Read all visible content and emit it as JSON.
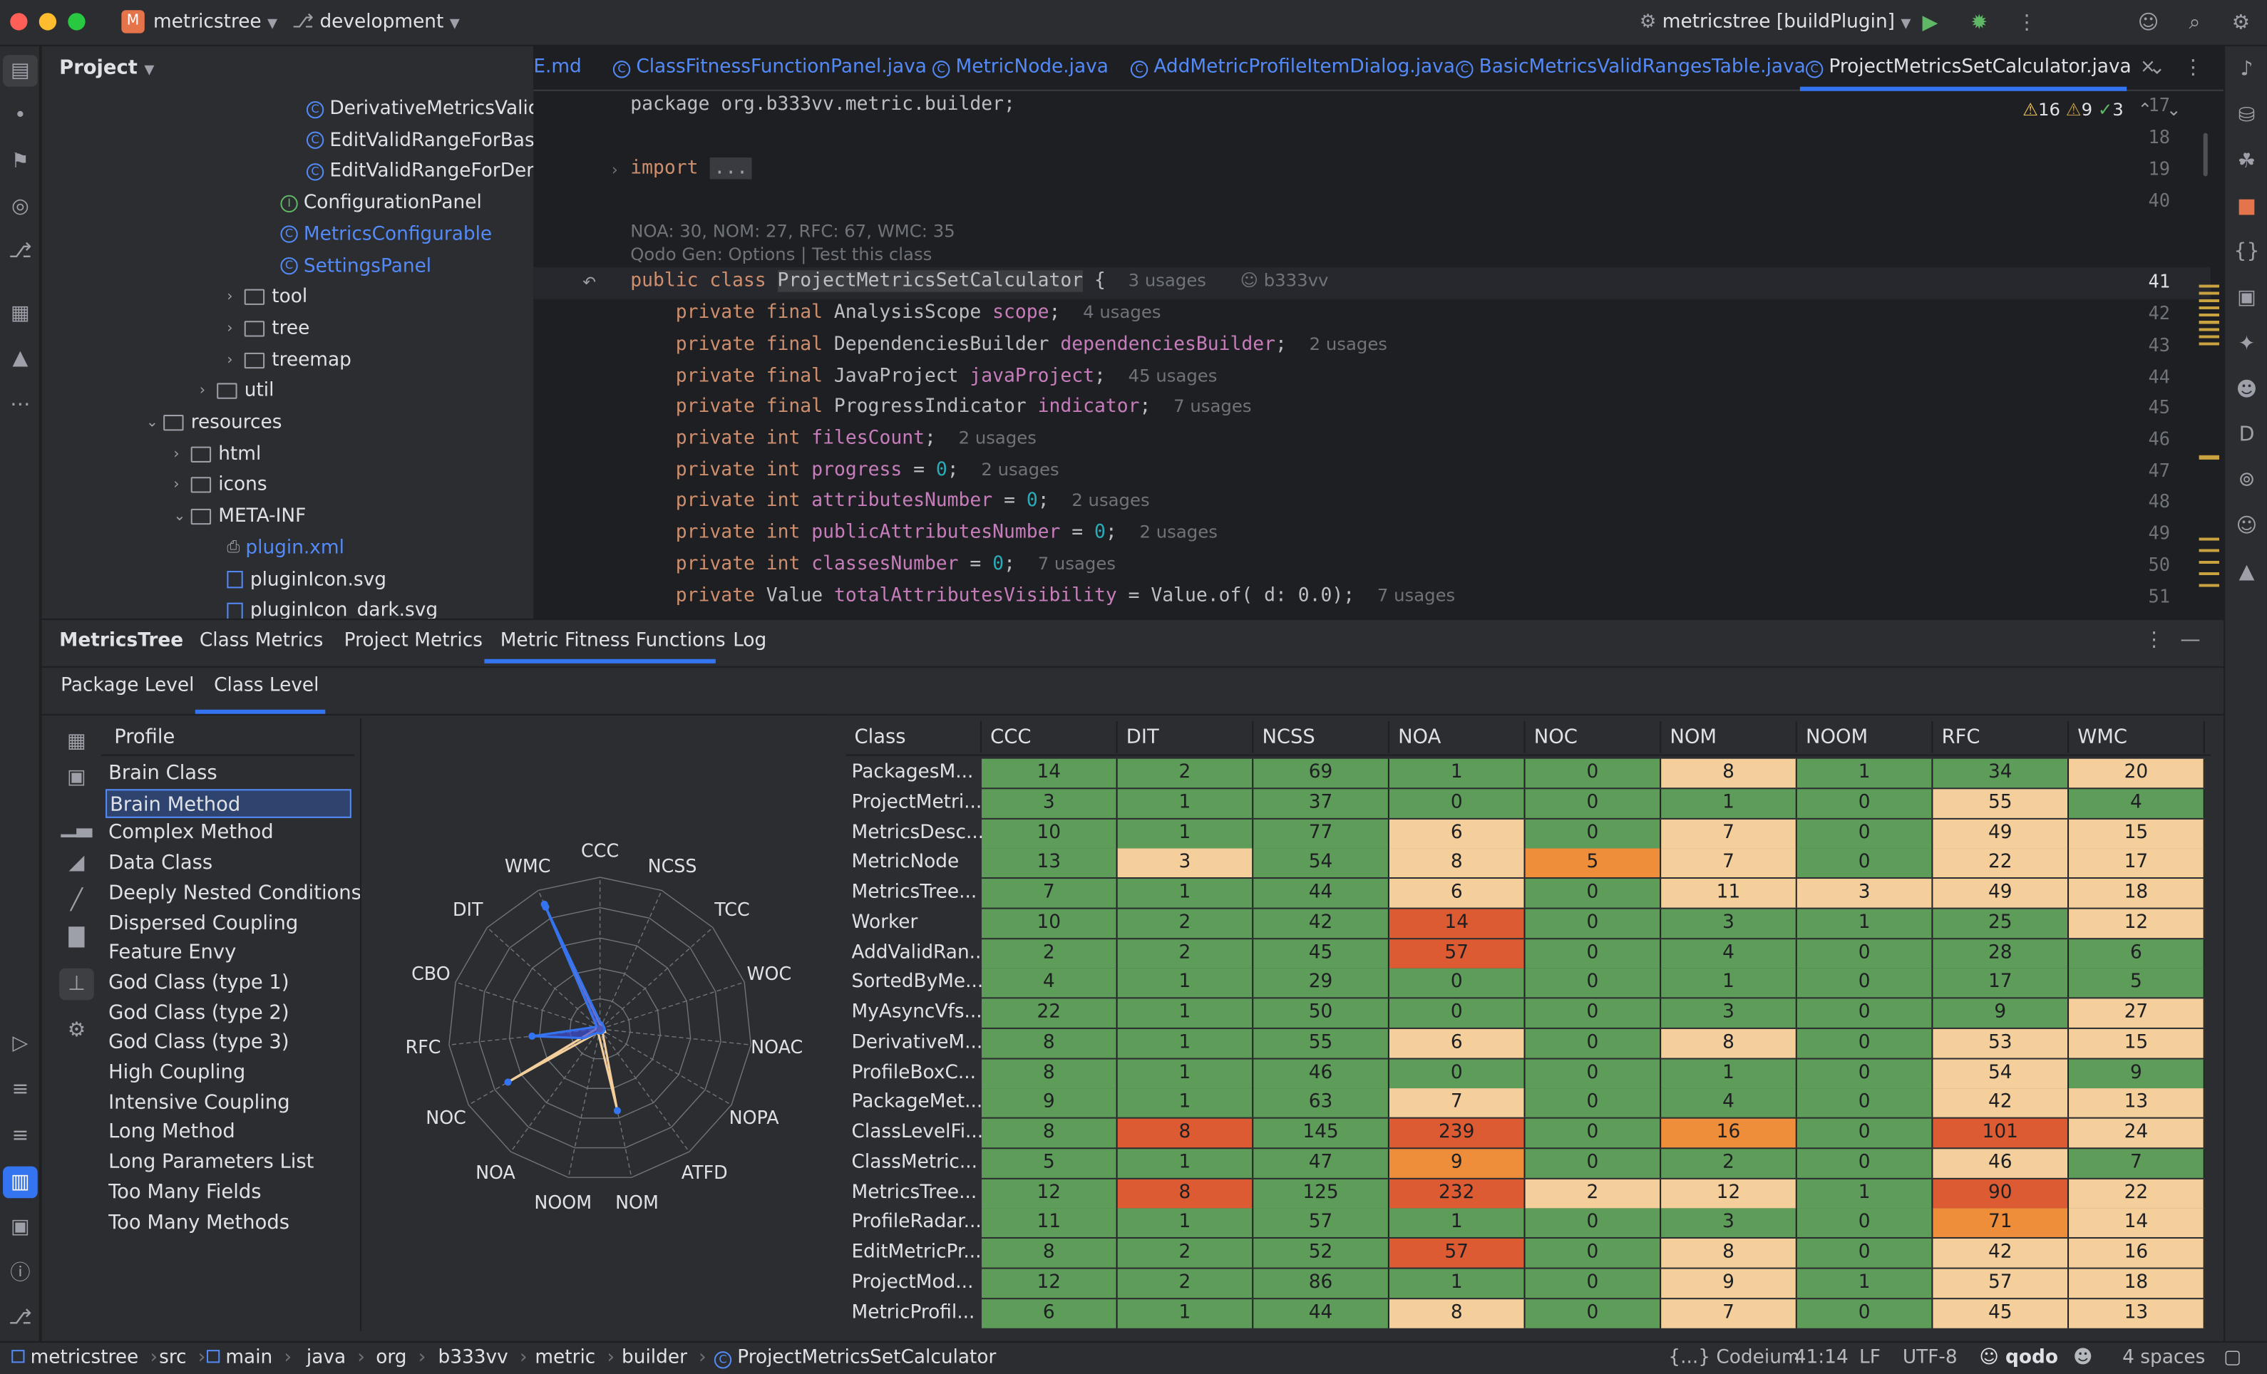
{
  "titlebar": {
    "project_initial": "M",
    "project": "metricstree",
    "branch": "development",
    "run_config": "metricstree [buildPlugin]"
  },
  "colors": {
    "green": "#5e9c5a",
    "tan": "#f4cf9c",
    "orange": "#ee8e3a",
    "red": "#dd5b33",
    "accent": "#3574f0",
    "selection": "#2e436e"
  },
  "project_panel": {
    "title": "Project",
    "items": [
      {
        "label": "DerivativeMetricsValidR",
        "kind": "class"
      },
      {
        "label": "EditValidRangeForBasic",
        "kind": "class"
      },
      {
        "label": "EditValidRangeForDeriv",
        "kind": "class"
      },
      {
        "label": "ConfigurationPanel",
        "kind": "interface"
      },
      {
        "label": "MetricsConfigurable",
        "kind": "class",
        "highlight": true
      },
      {
        "label": "SettingsPanel",
        "kind": "class",
        "highlight": true
      },
      {
        "label": "tool",
        "kind": "folder"
      },
      {
        "label": "tree",
        "kind": "folder"
      },
      {
        "label": "treemap",
        "kind": "folder"
      },
      {
        "label": "util",
        "kind": "folder"
      },
      {
        "label": "resources",
        "kind": "folder"
      },
      {
        "label": "html",
        "kind": "folder"
      },
      {
        "label": "icons",
        "kind": "folder"
      },
      {
        "label": "META-INF",
        "kind": "folder"
      },
      {
        "label": "plugin.xml",
        "kind": "xml"
      },
      {
        "label": "pluginIcon.svg",
        "kind": "svg"
      },
      {
        "label": "pluginIcon_dark.svg",
        "kind": "svg"
      }
    ]
  },
  "editor": {
    "tabs": [
      "E.md",
      "ClassFitnessFunctionPanel.java",
      "MetricNode.java",
      "AddMetricProfileItemDialog.java",
      "BasicMetricsValidRangesTable.java",
      "ProjectMetricsSetCalculator.java"
    ],
    "inspections": {
      "warnings": "16",
      "weak": "9",
      "ok": "3"
    },
    "line_numbers": [
      "17",
      "18",
      "19",
      "40",
      "41",
      "42",
      "43",
      "44",
      "45",
      "46",
      "47",
      "48",
      "49",
      "50",
      "51"
    ],
    "package_line": "package org.b333vv.metric.builder;",
    "import_line": "import",
    "import_fold": "...",
    "metrics_hint": "NOA: 30, NOM: 27, RFC: 67, WMC: 35",
    "qodo_hint": "Qodo Gen: Options | Test this class",
    "class_line": {
      "kw": "public class",
      "name": "ProjectMetricsSetCalculator",
      "brace": "{",
      "usages": "3 usages",
      "author": "b333vv"
    },
    "fields": [
      {
        "type": "AnalysisScope",
        "name": "scope",
        "init": "",
        "usages": "4 usages"
      },
      {
        "type": "DependenciesBuilder",
        "name": "dependenciesBuilder",
        "init": "",
        "usages": "2 usages"
      },
      {
        "type": "JavaProject",
        "name": "javaProject",
        "init": "",
        "usages": "45 usages"
      },
      {
        "type": "ProgressIndicator",
        "name": "indicator",
        "init": "",
        "usages": "7 usages"
      },
      {
        "type": "int",
        "name": "filesCount",
        "init": "",
        "usages": "2 usages"
      },
      {
        "type": "int",
        "name": "progress",
        "init": "0",
        "usages": "2 usages"
      },
      {
        "type": "int",
        "name": "attributesNumber",
        "init": "0",
        "usages": "2 usages"
      },
      {
        "type": "int",
        "name": "publicAttributesNumber",
        "init": "0",
        "usages": "2 usages"
      },
      {
        "type": "int",
        "name": "classesNumber",
        "init": "0",
        "usages": "7 usages"
      },
      {
        "type": "Value",
        "name": "totalAttributesVisibility",
        "init": "Value.of( d: 0.0)",
        "usages": "7 usages"
      }
    ]
  },
  "tool_window": {
    "title": "MetricsTree",
    "tabs": [
      "Class Metrics",
      "Project Metrics",
      "Metric Fitness Functions",
      "Log"
    ],
    "subtabs": [
      "Package Level",
      "Class Level"
    ],
    "profile_header": "Profile",
    "profiles": [
      "Brain Class",
      "Brain Method",
      "Complex Method",
      "Data Class",
      "Deeply Nested Conditions",
      "Dispersed Coupling",
      "Feature Envy",
      "God Class (type 1)",
      "God Class (type 2)",
      "God Class (type 3)",
      "High Coupling",
      "Intensive Coupling",
      "Long Method",
      "Long Parameters List",
      "Too Many Fields",
      "Too Many Methods"
    ],
    "selected_profile": "Brain Method"
  },
  "radar": {
    "axes": [
      "CCC",
      "NCSS",
      "TCC",
      "WOC",
      "NOAC",
      "NOPA",
      "ATFD",
      "NOM",
      "NOOM",
      "NOA",
      "NOC",
      "RFC",
      "CBO",
      "DIT",
      "WMC"
    ],
    "blue_shape": [
      0.05,
      0.04,
      0.03,
      0.03,
      0.03,
      0.03,
      0.03,
      0.03,
      0.03,
      0.03,
      0.12,
      0.45,
      0.04,
      0.03,
      0.9
    ],
    "tan_shape": [
      0.03,
      0.03,
      0.03,
      0.03,
      0.03,
      0.04,
      0.03,
      0.55,
      0.04,
      0.03,
      0.7,
      0.03,
      0.03,
      0.03,
      0.88
    ]
  },
  "table": {
    "columns": [
      "Class",
      "CCC",
      "DIT",
      "NCSS",
      "NOA",
      "NOC",
      "NOM",
      "NOOM",
      "RFC",
      "WMC"
    ],
    "rows": [
      {
        "name": "PackagesM...",
        "v": [
          "14",
          "2",
          "69",
          "1",
          "0",
          "8",
          "1",
          "34",
          "20"
        ],
        "c": [
          "g",
          "g",
          "g",
          "g",
          "g",
          "t",
          "g",
          "g",
          "t"
        ]
      },
      {
        "name": "ProjectMetri...",
        "v": [
          "3",
          "1",
          "37",
          "0",
          "0",
          "1",
          "0",
          "55",
          "4"
        ],
        "c": [
          "g",
          "g",
          "g",
          "g",
          "g",
          "g",
          "g",
          "t",
          "g"
        ]
      },
      {
        "name": "MetricsDesc...",
        "v": [
          "10",
          "1",
          "77",
          "6",
          "0",
          "7",
          "0",
          "49",
          "15"
        ],
        "c": [
          "g",
          "g",
          "g",
          "t",
          "g",
          "t",
          "g",
          "t",
          "t"
        ]
      },
      {
        "name": "MetricNode",
        "v": [
          "13",
          "3",
          "54",
          "8",
          "5",
          "7",
          "0",
          "22",
          "17"
        ],
        "c": [
          "g",
          "t",
          "g",
          "t",
          "o",
          "t",
          "g",
          "t",
          "t"
        ]
      },
      {
        "name": "MetricsTree...",
        "v": [
          "7",
          "1",
          "44",
          "6",
          "0",
          "11",
          "3",
          "49",
          "18"
        ],
        "c": [
          "g",
          "g",
          "g",
          "t",
          "g",
          "t",
          "t",
          "t",
          "t"
        ]
      },
      {
        "name": "Worker",
        "v": [
          "10",
          "2",
          "42",
          "14",
          "0",
          "3",
          "1",
          "25",
          "12"
        ],
        "c": [
          "g",
          "g",
          "g",
          "r",
          "g",
          "g",
          "g",
          "g",
          "t"
        ]
      },
      {
        "name": "AddValidRan...",
        "v": [
          "2",
          "2",
          "45",
          "57",
          "0",
          "4",
          "0",
          "28",
          "6"
        ],
        "c": [
          "g",
          "g",
          "g",
          "r",
          "g",
          "g",
          "g",
          "g",
          "g"
        ]
      },
      {
        "name": "SortedByMe...",
        "v": [
          "4",
          "1",
          "29",
          "0",
          "0",
          "1",
          "0",
          "17",
          "5"
        ],
        "c": [
          "g",
          "g",
          "g",
          "g",
          "g",
          "g",
          "g",
          "g",
          "g"
        ]
      },
      {
        "name": "MyAsyncVfs...",
        "v": [
          "22",
          "1",
          "50",
          "0",
          "0",
          "3",
          "0",
          "9",
          "27"
        ],
        "c": [
          "g",
          "g",
          "g",
          "g",
          "g",
          "g",
          "g",
          "g",
          "t"
        ]
      },
      {
        "name": "DerivativeM...",
        "v": [
          "8",
          "1",
          "55",
          "6",
          "0",
          "8",
          "0",
          "53",
          "15"
        ],
        "c": [
          "g",
          "g",
          "g",
          "t",
          "g",
          "t",
          "g",
          "t",
          "t"
        ]
      },
      {
        "name": "ProfileBoxC...",
        "v": [
          "8",
          "1",
          "46",
          "0",
          "0",
          "1",
          "0",
          "54",
          "9"
        ],
        "c": [
          "g",
          "g",
          "g",
          "g",
          "g",
          "g",
          "g",
          "t",
          "g"
        ]
      },
      {
        "name": "PackageMet...",
        "v": [
          "9",
          "1",
          "63",
          "7",
          "0",
          "4",
          "0",
          "42",
          "13"
        ],
        "c": [
          "g",
          "g",
          "g",
          "t",
          "g",
          "g",
          "g",
          "t",
          "t"
        ]
      },
      {
        "name": "ClassLevelFi...",
        "v": [
          "8",
          "8",
          "145",
          "239",
          "0",
          "16",
          "0",
          "101",
          "24"
        ],
        "c": [
          "g",
          "r",
          "g",
          "r",
          "g",
          "o",
          "g",
          "r",
          "t"
        ]
      },
      {
        "name": "ClassMetric...",
        "v": [
          "5",
          "1",
          "47",
          "9",
          "0",
          "2",
          "0",
          "46",
          "7"
        ],
        "c": [
          "g",
          "g",
          "g",
          "o",
          "g",
          "g",
          "g",
          "t",
          "g"
        ]
      },
      {
        "name": "MetricsTree...",
        "v": [
          "12",
          "8",
          "125",
          "232",
          "2",
          "12",
          "1",
          "90",
          "22"
        ],
        "c": [
          "g",
          "r",
          "g",
          "r",
          "t",
          "t",
          "g",
          "r",
          "t"
        ]
      },
      {
        "name": "ProfileRadar...",
        "v": [
          "11",
          "1",
          "57",
          "1",
          "0",
          "3",
          "0",
          "71",
          "14"
        ],
        "c": [
          "g",
          "g",
          "g",
          "g",
          "g",
          "g",
          "g",
          "o",
          "t"
        ]
      },
      {
        "name": "EditMetricPr...",
        "v": [
          "8",
          "2",
          "52",
          "57",
          "0",
          "8",
          "0",
          "42",
          "16"
        ],
        "c": [
          "g",
          "g",
          "g",
          "r",
          "g",
          "t",
          "g",
          "t",
          "t"
        ]
      },
      {
        "name": "ProjectMod...",
        "v": [
          "12",
          "2",
          "86",
          "1",
          "0",
          "9",
          "1",
          "57",
          "18"
        ],
        "c": [
          "g",
          "g",
          "g",
          "g",
          "g",
          "t",
          "g",
          "t",
          "t"
        ]
      },
      {
        "name": "MetricProfil...",
        "v": [
          "6",
          "1",
          "44",
          "8",
          "0",
          "7",
          "0",
          "45",
          "13"
        ],
        "c": [
          "g",
          "g",
          "g",
          "t",
          "g",
          "t",
          "g",
          "t",
          "t"
        ]
      }
    ]
  },
  "statusbar": {
    "crumbs": [
      "metricstree",
      "src",
      "main",
      "java",
      "org",
      "b333vv",
      "metric",
      "builder",
      "ProjectMetricsSetCalculator"
    ],
    "codeium": "{...} Codeium",
    "position": "41:14",
    "line_sep": "LF",
    "encoding": "UTF-8",
    "qodo": "qodo",
    "indent": "4 spaces"
  }
}
